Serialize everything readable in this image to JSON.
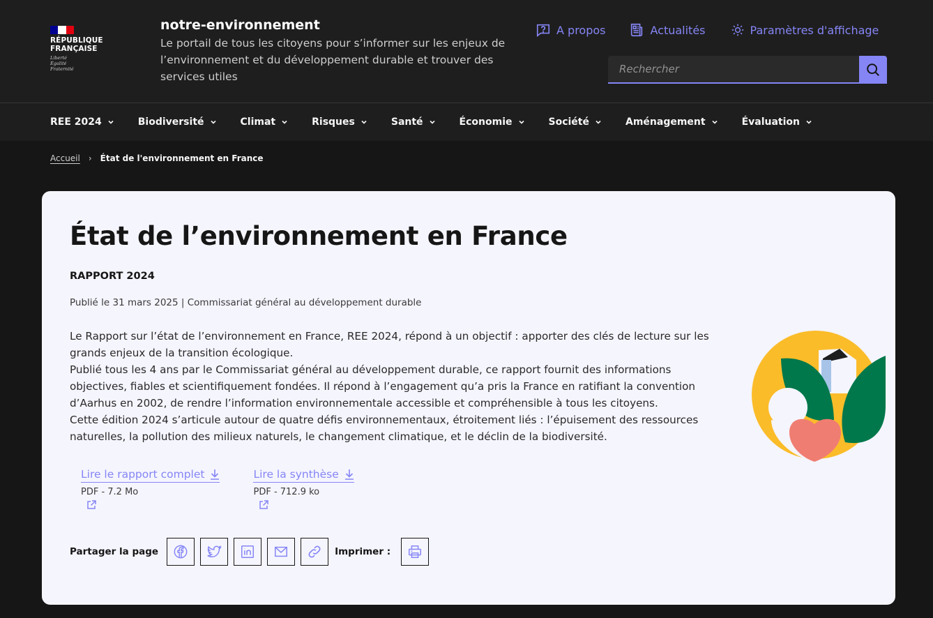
{
  "logo": {
    "title_line1": "RÉPUBLIQUE",
    "title_line2": "FRANÇAISE",
    "motto_line1": "Liberté",
    "motto_line2": "Égalité",
    "motto_line3": "Fraternité"
  },
  "service": {
    "title": "notre-environnement",
    "tagline": "Le portail de tous les citoyens pour s’informer sur les enjeux de l’environnement et du développement durable et trouver des services utiles"
  },
  "tools": {
    "about": "A propos",
    "news": "Actualités",
    "display": "Paramètres d'affichage"
  },
  "search": {
    "placeholder": "Rechercher"
  },
  "nav": {
    "items": [
      "REE 2024",
      "Biodiversité",
      "Climat",
      "Risques",
      "Santé",
      "Économie",
      "Société",
      "Aménagement",
      "Évaluation"
    ]
  },
  "breadcrumb": {
    "home": "Accueil",
    "current": "État de l'environnement en France"
  },
  "article": {
    "title": "État de l’environnement en France",
    "kicker": "RAPPORT 2024",
    "meta": "Publié le  31 mars 2025 | Commissariat général au développement durable",
    "paragraphs": [
      "Le Rapport sur l’état de l’environnement en France, REE 2024, répond à un objectif : apporter des clés de lecture sur les grands enjeux de la transition écologique.",
      "Publié tous les 4 ans par le Commissariat général au développement durable, ce rapport fournit des informations objectives, fiables et scientifiquement fondées. Il répond à l’engagement qu’a pris la France en ratifiant la convention d’Aarhus en 2002, de rendre l’information environnementale accessible et compréhensible à tous les citoyens.",
      "Cette édition 2024 s’articule autour de quatre défis environnementaux, étroitement liés : l’épuisement des ressources naturelles, la pollution des milieux naturels, le changement climatique, et le déclin de la biodiversité."
    ]
  },
  "downloads": [
    {
      "label": "Lire le rapport complet",
      "meta": "PDF - 7.2 Mo"
    },
    {
      "label": "Lire la synthèse",
      "meta": "PDF - 712.9 ko"
    }
  ],
  "share": {
    "label": "Partager la page",
    "print_label": "Imprimer :"
  },
  "colors": {
    "accent": "#8585f6",
    "background": "#161616",
    "header": "#1e1e1e",
    "card": "#f5f5fe"
  }
}
